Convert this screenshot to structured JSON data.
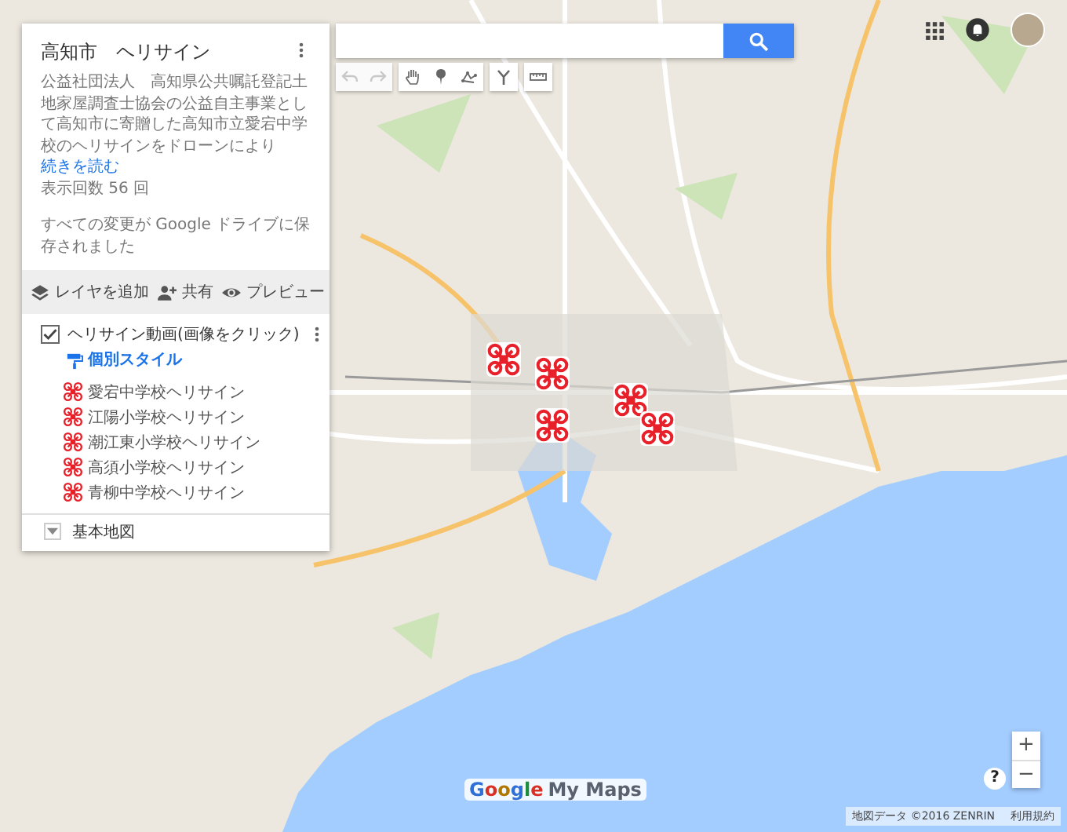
{
  "panel": {
    "title": "高知市　ヘリサイン",
    "description": "公益社団法人　高知県公共嘱託登記土地家屋調査士協会の公益自主事業として高知市に寄贈した高知市立愛宕中学校のヘリサインをドローンにより",
    "read_more": "続きを読む",
    "views": "表示回数 56 回",
    "save_status": "すべての変更が Google ドライブに保存されました",
    "actions": [
      {
        "kind": "layers",
        "label": "レイヤを追加"
      },
      {
        "kind": "share",
        "label": "共有"
      },
      {
        "kind": "preview",
        "label": "プレビュー"
      }
    ],
    "layer": {
      "title": "ヘリサイン動画(画像をクリック)",
      "checked": true,
      "style_link": "個別スタイル",
      "items": [
        {
          "label": "愛宕中学校ヘリサイン"
        },
        {
          "label": "江陽小学校ヘリサイン"
        },
        {
          "label": "潮江東小学校ヘリサイン"
        },
        {
          "label": "高須小学校ヘリサイン"
        },
        {
          "label": "青柳中学校ヘリサイン"
        }
      ]
    },
    "base_map": {
      "label": "基本地図",
      "expanded": false
    }
  },
  "toolbar": [
    {
      "kind": "undo",
      "disabled": true
    },
    {
      "kind": "redo",
      "disabled": true
    },
    {
      "kind": "hand",
      "disabled": false
    },
    {
      "kind": "marker",
      "disabled": false
    },
    {
      "kind": "line",
      "disabled": false
    },
    {
      "kind": "route",
      "disabled": false
    },
    {
      "kind": "ruler",
      "disabled": false
    }
  ],
  "zoom_controls": [
    "+",
    "−"
  ],
  "help": "?",
  "logo": {
    "brand": "Google",
    "product": "My Maps"
  },
  "attribution": {
    "data": "地図データ ©2016 ZENRIN",
    "terms": "利用規約"
  }
}
